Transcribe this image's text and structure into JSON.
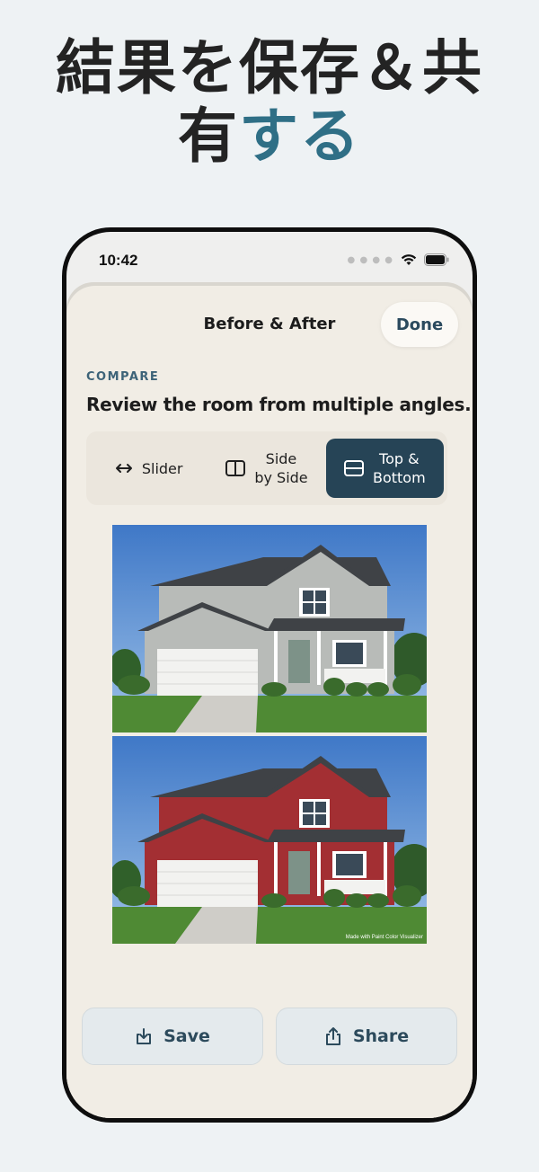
{
  "headline": {
    "line1": "結果を保存＆共",
    "line2_plain": "有",
    "line2_accent": "する"
  },
  "status_bar": {
    "time": "10:42"
  },
  "sheet": {
    "title": "Before & After",
    "done_label": "Done",
    "section_label": "COMPARE",
    "section_desc": "Review the room from multiple angles."
  },
  "view_modes": [
    {
      "label": "Slider",
      "icon": "arrows-horizontal-icon",
      "active": false
    },
    {
      "label": "Side\nby Side",
      "icon": "split-vertical-icon",
      "active": false
    },
    {
      "label": "Top &\nBottom",
      "icon": "split-horizontal-icon",
      "active": true
    }
  ],
  "photos": {
    "before_colors": {
      "siding": "#b8bbb8",
      "roof": "#45484c"
    },
    "after_colors": {
      "siding": "#a32f33",
      "roof": "#45484c"
    },
    "watermark": "Made with Paint Color Visualizer"
  },
  "actions": {
    "save_label": "Save",
    "share_label": "Share"
  },
  "colors": {
    "accent": "#2f6f86",
    "active_segment": "#264456",
    "button_text": "#2c4a5c"
  }
}
